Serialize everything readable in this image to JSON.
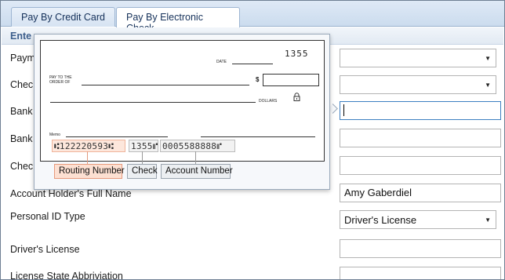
{
  "tabs": [
    {
      "label": "Pay By Credit Card",
      "active": false
    },
    {
      "label": "Pay By Electronic Check",
      "active": true
    }
  ],
  "section": {
    "title": "Ente"
  },
  "form": {
    "labels": {
      "payment": "Paym",
      "check": "Chec",
      "bank1": "Bank",
      "bank2": "Bank",
      "check2": "Chec",
      "holder": "Account Holder's Full Name",
      "id_type": "Personal ID Type",
      "license": "Driver's License",
      "license_state": "License State Abbriviation"
    },
    "values": {
      "payment_select": "",
      "check_select": "",
      "bank1": "",
      "bank2": "",
      "check2": "",
      "holder": "Amy Gaberdiel",
      "id_type": "Driver's License",
      "license": "",
      "license_state": ""
    }
  },
  "check_popup": {
    "check_number": "1355",
    "date_label": "DATE",
    "pay_to_label": "PAY TO THE",
    "order_of_label": "ORDER OF",
    "dollar_sign": "$",
    "dollars_label": "DOLLARS",
    "memo_label": "Memo",
    "micr": {
      "routing": "⑆122220593⑆",
      "check": "1355⑈",
      "account": "0005588888⑈"
    },
    "legend": {
      "routing": "Routing Number",
      "check": "Check",
      "account": "Account Number"
    },
    "accent_colors": {
      "routing": "#fde0d2",
      "routing_border": "#e79a7d"
    }
  }
}
